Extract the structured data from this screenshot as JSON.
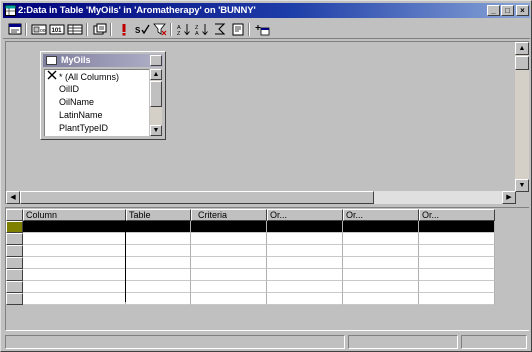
{
  "window": {
    "title": "2:Data in Table 'MyOils' in 'Aromatherapy' on 'BUNNY'",
    "controls": {
      "minimize": "_",
      "maximize": "□",
      "close": "×"
    }
  },
  "toolbar": {
    "buttons": [
      "sql-pane-icon",
      "diagram-pane-icon",
      "grid-pane-icon",
      "results-pane-icon",
      "change-query-type-icon",
      "run-icon",
      "verify-sql-icon",
      "remove-filter-icon",
      "sort-ascending-icon",
      "sort-descending-icon",
      "use-group-by-icon",
      "properties-icon",
      "add-table-icon"
    ]
  },
  "table_window": {
    "title": "MyOils",
    "fields": [
      "* (All Columns)",
      "OilID",
      "OilName",
      "LatinName",
      "PlantTypeID"
    ]
  },
  "grid": {
    "columns": [
      "Column",
      "Table",
      "Criteria",
      "Or...",
      "Or...",
      "Or..."
    ],
    "row_count": 7,
    "active_row": 0
  },
  "colors": {
    "titlebar_start": "#00007a",
    "titlebar_end": "#8aa6d8",
    "face": "#c0c0c0",
    "selection": "#000000"
  }
}
